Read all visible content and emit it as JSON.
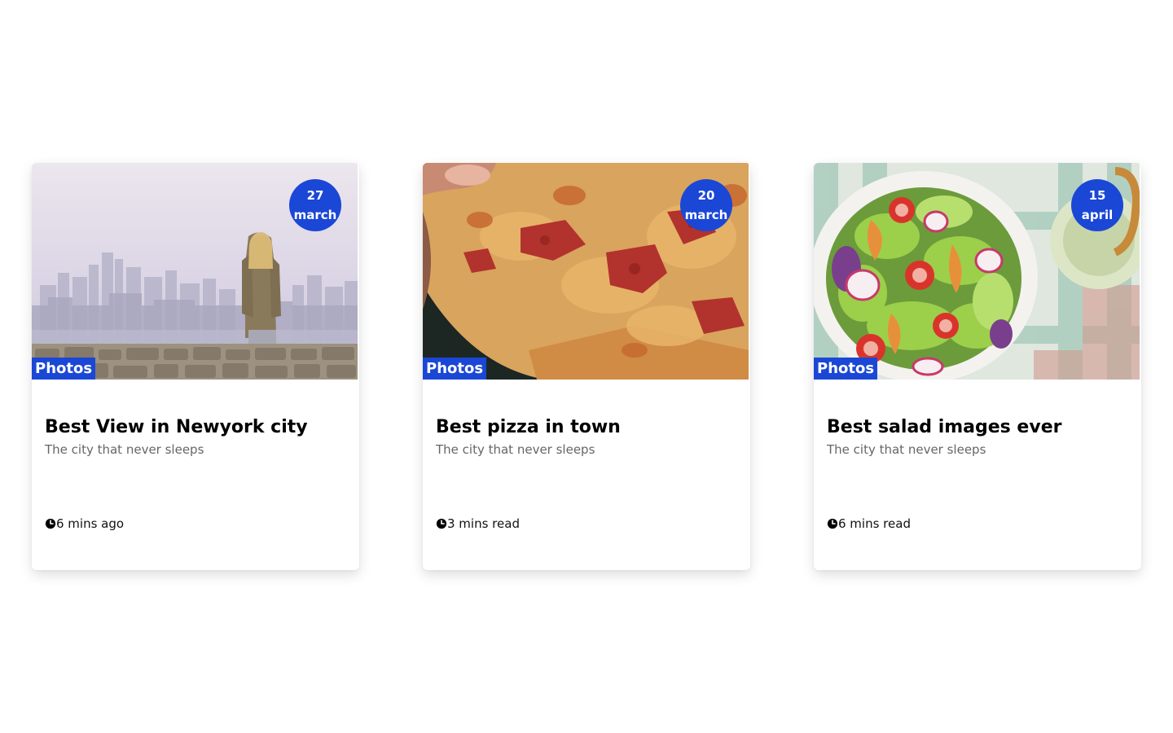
{
  "colors": {
    "accent": "#1b47d6",
    "subtitle": "#666666"
  },
  "cards": [
    {
      "image": "city-skyline-photo",
      "date_day": "27",
      "date_month": "march",
      "category": "Photos",
      "title": "Best View in Newyork city",
      "subtitle": "The city that never sleeps",
      "meta_icon": "clock-icon",
      "meta_text": "6 mins ago"
    },
    {
      "image": "pizza-photo",
      "date_day": "20",
      "date_month": "march",
      "category": "Photos",
      "title": "Best pizza in town",
      "subtitle": "The city that never sleeps",
      "meta_icon": "clock-icon",
      "meta_text": "3 mins read"
    },
    {
      "image": "salad-photo",
      "date_day": "15",
      "date_month": "april",
      "category": "Photos",
      "title": "Best salad images ever",
      "subtitle": "The city that never sleeps",
      "meta_icon": "clock-icon",
      "meta_text": "6 mins read"
    }
  ]
}
